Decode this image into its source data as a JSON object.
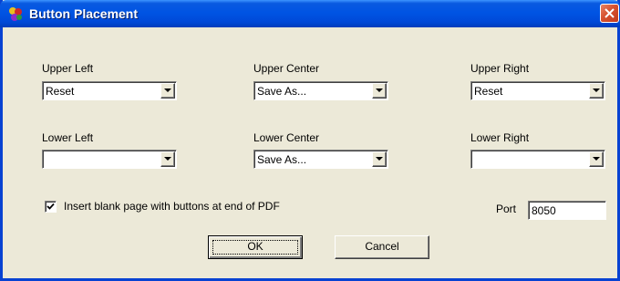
{
  "window": {
    "title": "Button Placement",
    "app_icon": "app-icon",
    "close_icon": "close-icon"
  },
  "fields": {
    "upper_left": {
      "label": "Upper Left",
      "value": "Reset"
    },
    "upper_center": {
      "label": "Upper Center",
      "value": "Save As..."
    },
    "upper_right": {
      "label": "Upper Right",
      "value": "Reset"
    },
    "lower_left": {
      "label": "Lower Left",
      "value": ""
    },
    "lower_center": {
      "label": "Lower Center",
      "value": "Save As..."
    },
    "lower_right": {
      "label": "Lower Right",
      "value": ""
    }
  },
  "insert_blank": {
    "label": "Insert blank page with buttons at end of PDF",
    "checked": true
  },
  "port": {
    "label": "Port",
    "value": "8050"
  },
  "buttons": {
    "ok": "OK",
    "cancel": "Cancel"
  },
  "colors": {
    "titlebar": "#0054e3",
    "face": "#ece9d8",
    "close": "#d6512f"
  }
}
